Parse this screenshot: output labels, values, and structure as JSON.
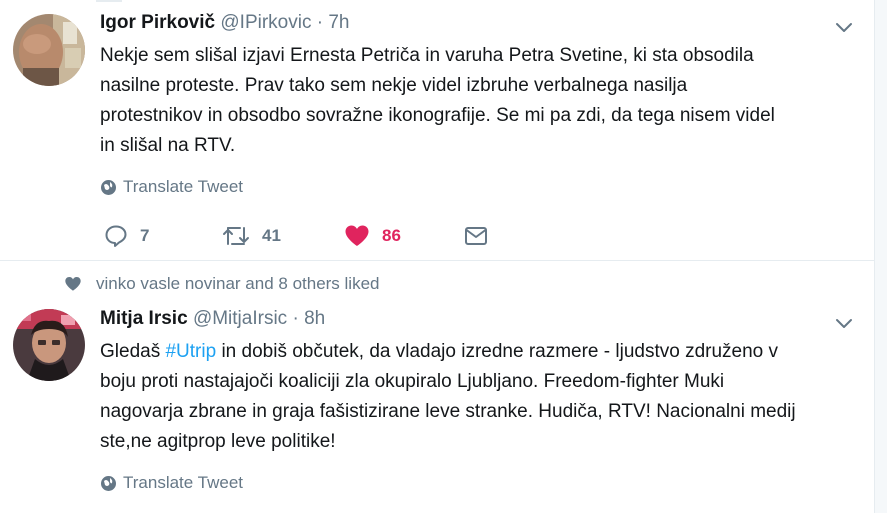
{
  "tweets": [
    {
      "author_name": "Igor Pirkovič",
      "handle": "@IPirkovic",
      "separator": "·",
      "time": "7h",
      "text_lines": [
        "Nekje sem slišal izjavi Ernesta Petriča in varuha Petra Svetine, ki sta obsodila",
        "nasilne proteste. Prav tako sem nekje videl izbruhe verbalnega nasilja",
        "protestnikov in obsodbo sovražne ikonografije. Se mi pa zdi, da tega nisem videl",
        "in slišal na RTV."
      ],
      "translate_label": "Translate Tweet",
      "reply_count": "7",
      "retweet_count": "41",
      "like_count": "86",
      "liked": true,
      "icons": {
        "reply": "reply-icon",
        "retweet": "retweet-icon",
        "like": "heart-icon",
        "dm": "envelope-icon",
        "menu": "chevron-down-icon",
        "translate": "globe-icon"
      }
    },
    {
      "social_context": "vinko vasle novinar and 8 others liked",
      "author_name": "Mitja Irsic",
      "handle": "@MitjaIrsic",
      "separator": "·",
      "time": "8h",
      "line1_before": "Gledaš ",
      "hashtag": "#Utrip",
      "line1_after": " in dobiš občutek, da vladajo izredne razmere - ljudstvo združeno v",
      "text_lines": [
        "boju proti nastajajoči koaliciji zla okupiralo Ljubljano. Freedom-fighter Muki",
        "nagovarja zbrane in graja fašistizirane leve stranke. Hudiča, RTV! Nacionalni medij",
        "ste,ne agitprop leve politike!"
      ],
      "translate_label": "Translate Tweet"
    }
  ],
  "colors": {
    "text": "#14171a",
    "secondary": "#657786",
    "link": "#1da1f2",
    "like": "#e0245e",
    "border": "#e6ecf0"
  }
}
